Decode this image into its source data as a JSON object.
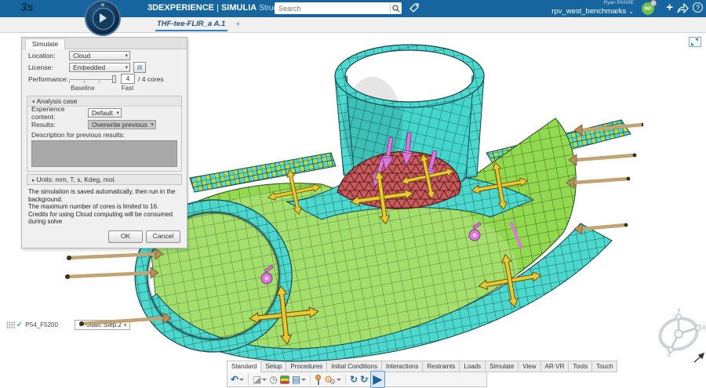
{
  "topbar": {
    "logo": "3s",
    "brand": "3DEXPERIENCE",
    "divider": "|",
    "app": "SIMULIA",
    "module": "Structural Scenario Creation",
    "search_placeholder": "Search",
    "user_name": "Ryan PANSE",
    "workspace": "rpv_west_benchmarks",
    "avatar_initials": "RP",
    "add_label": "+",
    "help_label": "?"
  },
  "doc_tab": {
    "label": "THF-tee-FLIR_a A.1",
    "new_tab": "+"
  },
  "dialog": {
    "tab": "Simulate",
    "location_label": "Location:",
    "location_value": "Cloud",
    "license_label": "License:",
    "license_value": "Embedded",
    "license_button_icon": "▤",
    "performance_label": "Performance:",
    "cores_value": "4",
    "cores_suffix": "/ 4 cores",
    "slider_min_label": "Baseline",
    "slider_max_label": "Fast",
    "analysis_case_header": "Analysis case",
    "experience_label": "Experience content:",
    "experience_value": "Default",
    "results_label": "Results:",
    "results_value": "Overwrite previous",
    "description_label": "Description for previous results:",
    "units_bar": "Units: mm, T, s, Kdeg, mol.",
    "info_lines": [
      "The simulation is saved automatically, then run in the background.",
      "The maximum number of cores is limited to 16.",
      "Credits for using Cloud computing will be consumed during solve"
    ],
    "ok_label": "OK",
    "cancel_label": "Cancel"
  },
  "viewport": {
    "mesh_label": "P54_F5200",
    "step_label": "Static Step.2",
    "triad": {
      "x": "X",
      "y": "Y",
      "z": "Z"
    }
  },
  "action_bar": {
    "tabs": [
      "Standard",
      "Setup",
      "Procedures",
      "Initial Conditions",
      "Interactions",
      "Restraints",
      "Loads",
      "Simulate",
      "View",
      "AR-VR",
      "Tools",
      "Touch"
    ],
    "active_tab": "Standard",
    "icons": [
      "undo",
      "part-display",
      "model-checks",
      "contour-results",
      "data-table",
      "diagnostic-probe",
      "settings-gears",
      "update",
      "validate",
      "run-simulation"
    ]
  },
  "colors": {
    "topbar_blue": "#16659e",
    "mesh_cyan": "#4cd8cd",
    "mesh_green": "#93d94f",
    "mesh_red": "#c75a5c",
    "arrow_yellow": "#eaca33",
    "symbol_pink": "#d77ad6",
    "rod_tan": "#c3a273",
    "avatar_green": "#6fc04a"
  }
}
